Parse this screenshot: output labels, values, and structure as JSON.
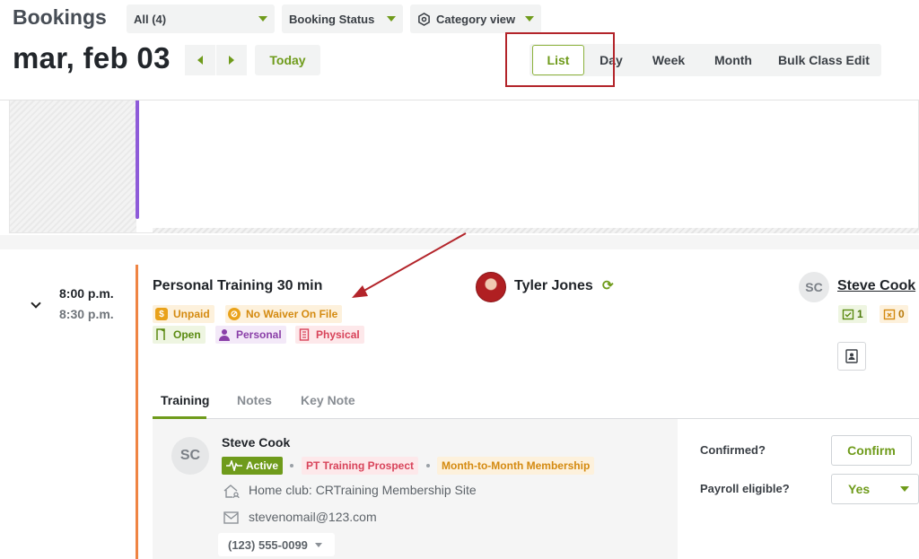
{
  "header": {
    "title": "Bookings",
    "filters": [
      {
        "label": "All (4)"
      },
      {
        "label": "Booking Status"
      },
      {
        "label": "Category view"
      }
    ],
    "date": "mar, feb 03",
    "today_label": "Today",
    "views": [
      "List",
      "Day",
      "Week",
      "Month",
      "Bulk Class Edit"
    ],
    "active_view": "List"
  },
  "booking": {
    "start_time": "8:00 p.m.",
    "end_time": "8:30 p.m.",
    "title": "Personal Training 30 min",
    "badges": [
      {
        "label": "Unpaid",
        "icon": "dollar-icon"
      },
      {
        "label": "No Waiver On File",
        "icon": "no-waiver-icon"
      },
      {
        "label": "Open",
        "icon": "door-icon"
      },
      {
        "label": "Personal",
        "icon": "person-icon"
      },
      {
        "label": "Physical",
        "icon": "building-icon"
      }
    ],
    "coach": "Tyler Jones",
    "client_initials": "SC",
    "client_name": "Steve Cook",
    "confirmed_count": "1",
    "cancelled_count": "0"
  },
  "tabs": [
    "Training",
    "Notes",
    "Key Note"
  ],
  "client": {
    "initials": "SC",
    "name": "Steve Cook",
    "status": "Active",
    "tags": [
      "PT Training Prospect",
      "Month-to-Month Membership"
    ],
    "home_club": "Home club: CRTraining Membership Site",
    "email": "stevenomail@123.com",
    "phone": "(123) 555-0099"
  },
  "form": {
    "confirmed_label": "Confirmed?",
    "confirm_button": "Confirm",
    "payroll_label": "Payroll eligible?",
    "payroll_value": "Yes"
  },
  "colors": {
    "accent": "#6f9b1b",
    "annotation": "#b3242a",
    "session_bar": "#ef8443",
    "previous_bar": "#8e5bd9"
  }
}
